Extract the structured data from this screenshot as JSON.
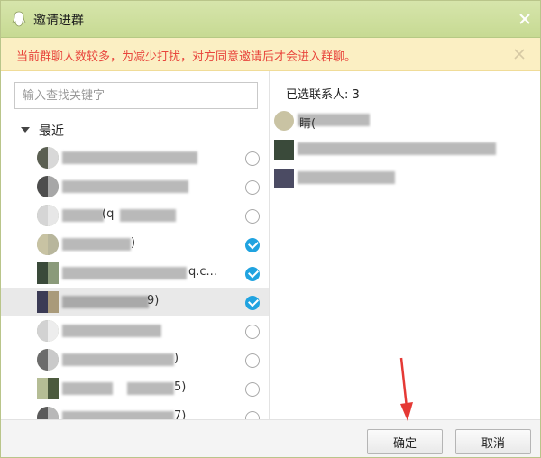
{
  "window": {
    "title": "邀请进群"
  },
  "notice": {
    "text": "当前群聊人数较多，为减少打扰，对方同意邀请后才会进入群聊。"
  },
  "search": {
    "placeholder": "输入查找关键字",
    "value": ""
  },
  "group": {
    "label": "最近"
  },
  "contacts": [
    {
      "suffix": "",
      "checked": false
    },
    {
      "suffix": "",
      "checked": false
    },
    {
      "suffix": "(q",
      "checked": false
    },
    {
      "suffix": ")",
      "checked": true
    },
    {
      "suffix": "q.c...",
      "checked": true
    },
    {
      "suffix": "9)",
      "checked": true
    },
    {
      "suffix": "",
      "checked": false
    },
    {
      "suffix": ")",
      "checked": false
    },
    {
      "suffix": "5)",
      "checked": false
    },
    {
      "suffix": "7)",
      "checked": false
    }
  ],
  "selected_panel": {
    "label": "已选联系人: 3"
  },
  "selected_items": [
    {
      "suffix": "睛("
    },
    {
      "suffix": ""
    },
    {
      "suffix": ""
    }
  ],
  "footer": {
    "ok_label": "确定",
    "cancel_label": "取消"
  },
  "colors": {
    "titlebar": "#cfe0a0",
    "notice_bg": "#fbefc3",
    "notice_text": "#e8453c",
    "check_on": "#20a3e0",
    "arrow": "#e53935"
  }
}
